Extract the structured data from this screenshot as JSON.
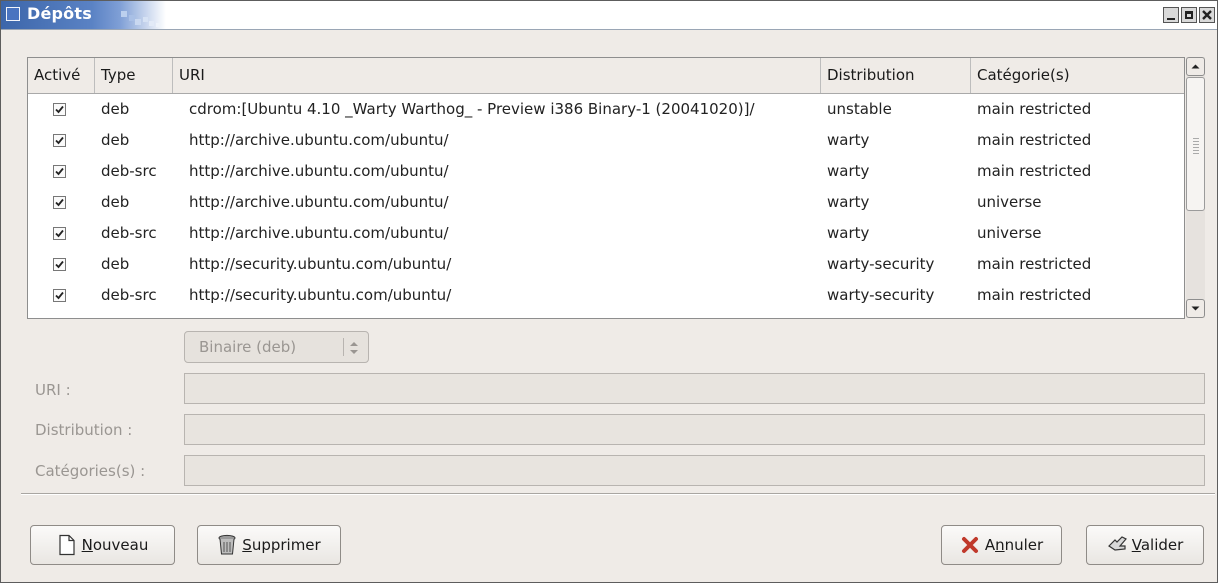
{
  "window": {
    "title": "Dépôts"
  },
  "list": {
    "columns": [
      "Activé",
      "Type",
      "URI",
      "Distribution",
      "Catégorie(s)"
    ],
    "rows": [
      {
        "enabled": true,
        "type": "deb",
        "uri": "cdrom:[Ubuntu 4.10 _Warty Warthog_ - Preview i386 Binary-1 (20041020)]/",
        "distribution": "unstable",
        "categories": "main restricted"
      },
      {
        "enabled": true,
        "type": "deb",
        "uri": "http://archive.ubuntu.com/ubuntu/",
        "distribution": "warty",
        "categories": "main restricted"
      },
      {
        "enabled": true,
        "type": "deb-src",
        "uri": "http://archive.ubuntu.com/ubuntu/",
        "distribution": "warty",
        "categories": "main restricted"
      },
      {
        "enabled": true,
        "type": "deb",
        "uri": "http://archive.ubuntu.com/ubuntu/",
        "distribution": "warty",
        "categories": "universe"
      },
      {
        "enabled": true,
        "type": "deb-src",
        "uri": "http://archive.ubuntu.com/ubuntu/",
        "distribution": "warty",
        "categories": "universe"
      },
      {
        "enabled": true,
        "type": "deb",
        "uri": "http://security.ubuntu.com/ubuntu/",
        "distribution": "warty-security",
        "categories": "main restricted"
      },
      {
        "enabled": true,
        "type": "deb-src",
        "uri": "http://security.ubuntu.com/ubuntu/",
        "distribution": "warty-security",
        "categories": "main restricted"
      }
    ]
  },
  "form": {
    "type_select": "Binaire (deb)",
    "uri_label": "URI :",
    "distribution_label": "Distribution :",
    "categories_label": "Catégories(s) :"
  },
  "buttons": {
    "new_key": "N",
    "new_rest": "ouveau",
    "delete_key": "S",
    "delete_rest": "upprimer",
    "cancel_pre": "A",
    "cancel_key": "n",
    "cancel_rest": "nuler",
    "ok_key": "V",
    "ok_rest": "alider"
  },
  "colors": {
    "title_bar": "#3c66aa",
    "background": "#efebe7",
    "cancel_icon": "#c0392b"
  }
}
